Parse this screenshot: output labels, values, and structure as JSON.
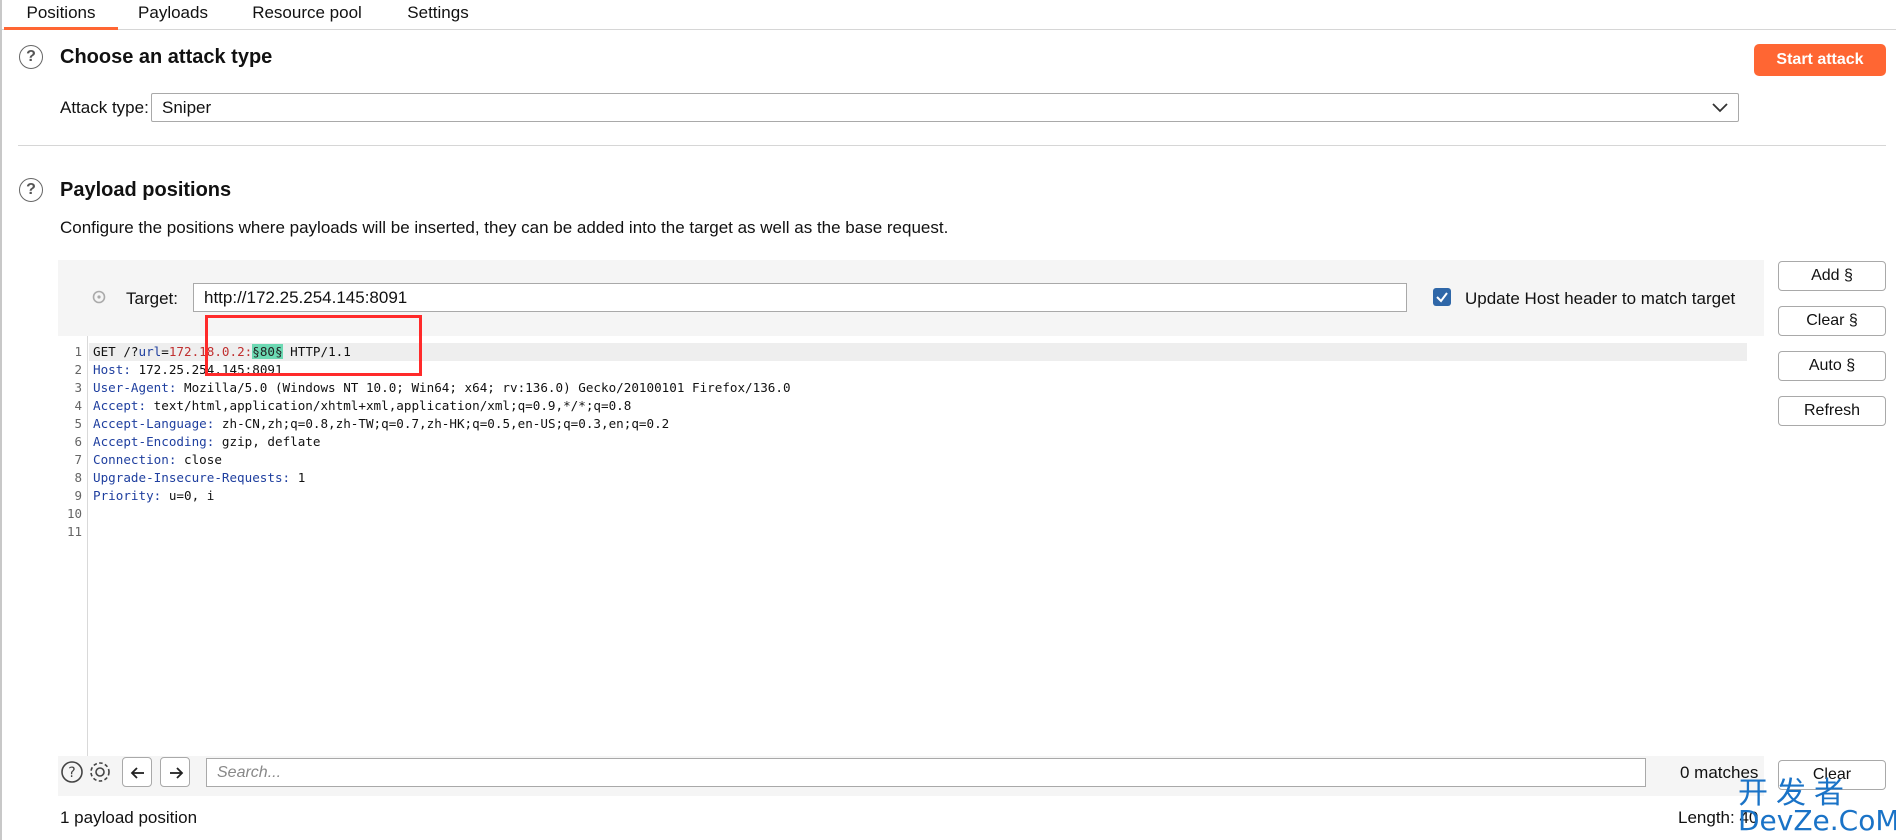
{
  "tabs": [
    {
      "label": "Positions",
      "active": true
    },
    {
      "label": "Payloads",
      "active": false
    },
    {
      "label": "Resource pool",
      "active": false
    },
    {
      "label": "Settings",
      "active": false
    }
  ],
  "attack_section": {
    "title": "Choose an attack type",
    "start_button": "Start attack",
    "attack_type_label": "Attack type:",
    "attack_type_value": "Sniper"
  },
  "payload_section": {
    "title": "Payload positions",
    "description": "Configure the positions where payloads will be inserted, they can be added into the target as well as the base request.",
    "target_label": "Target:",
    "target_value": "http://172.25.254.145:8091",
    "update_host_label": "Update Host header to match target",
    "update_host_checked": true
  },
  "side_buttons": [
    "Add §",
    "Clear §",
    "Auto §",
    "Refresh"
  ],
  "request_lines": {
    "l1_method": "GET /?",
    "l1_param": "url",
    "l1_eq": "=",
    "l1_value": "172.18.0.2:",
    "l1_payload": "§80§",
    "l1_rest": " HTTP/1.1",
    "l2_key": "Host:",
    "l2_val": " 172.25.254.145:8091",
    "l3_key": "User-Agent:",
    "l3_val": " Mozilla/5.0 (Windows NT 10.0; Win64; x64; rv:136.0) Gecko/20100101 Firefox/136.0",
    "l4_key": "Accept:",
    "l4_val": " text/html,application/xhtml+xml,application/xml;q=0.9,*/*;q=0.8",
    "l5_key": "Accept-Language:",
    "l5_val": " zh-CN,zh;q=0.8,zh-TW;q=0.7,zh-HK;q=0.5,en-US;q=0.3,en;q=0.2",
    "l6_key": "Accept-Encoding:",
    "l6_val": " gzip, deflate",
    "l7_key": "Connection:",
    "l7_val": " close",
    "l8_key": "Upgrade-Insecure-Requests:",
    "l8_val": " 1",
    "l9_key": "Priority:",
    "l9_val": " u=0, i"
  },
  "line_numbers": [
    "1",
    "2",
    "3",
    "4",
    "5",
    "6",
    "7",
    "8",
    "9",
    "10",
    "11"
  ],
  "search": {
    "placeholder": "Search...",
    "matches": "0 matches",
    "clear_label": "Clear"
  },
  "status": {
    "payload_count": "1 payload position",
    "length_label": "Length: 40"
  },
  "watermark": {
    "line1": "开发者",
    "line2": "DevZe.CoM"
  },
  "colors": {
    "accent": "#ff6633",
    "payload_highlight": "#6cd9b3",
    "header_key": "#1f3f9f",
    "param_value": "#c03030",
    "annotation_box": "#ff2a2a"
  }
}
